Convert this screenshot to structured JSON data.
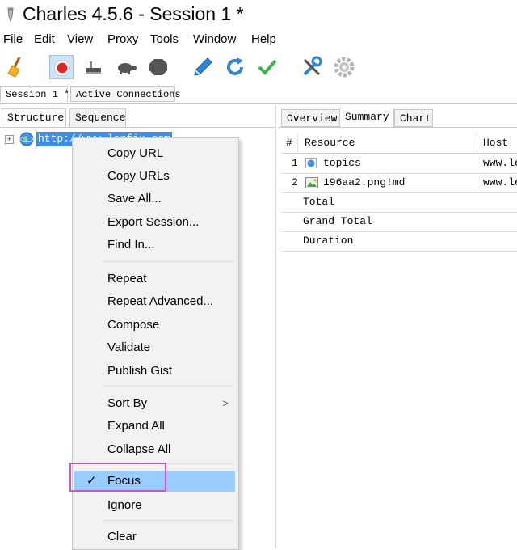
{
  "window": {
    "title": "Charles 4.5.6 - Session 1 *"
  },
  "menubar": {
    "items": [
      "File",
      "Edit",
      "View",
      "Proxy",
      "Tools",
      "Window",
      "Help"
    ]
  },
  "toolbar": {
    "icons": [
      "broom-icon",
      "record-icon",
      "throttle-icon",
      "turtle-icon",
      "stop-icon",
      "pen-icon",
      "refresh-icon",
      "checkmark-icon",
      "tools-icon",
      "settings-gear-icon"
    ],
    "record_color": "#e02424",
    "accent_blue": "#2f86d6",
    "check_green": "#3bb54a"
  },
  "session_tabs": [
    "Session 1 *",
    "Active Connections"
  ],
  "left_pane": {
    "tabs": [
      "Structure",
      "Sequence"
    ],
    "tree": {
      "expander": "+",
      "host": "http://www.lerfix.com"
    }
  },
  "right_pane": {
    "tabs": [
      "Overview",
      "Summary",
      "Chart"
    ],
    "table": {
      "columns": [
        "#",
        "Resource",
        "Host"
      ],
      "rows": [
        {
          "num": "1",
          "resource": "topics",
          "host": "www.le",
          "icon": "globe-icon"
        },
        {
          "num": "2",
          "resource": "196aa2.png!md",
          "host": "www.le",
          "icon": "image-icon"
        }
      ],
      "summary_rows": [
        "Total",
        "Grand Total",
        "Duration"
      ]
    }
  },
  "context_menu": {
    "groups": [
      [
        "Copy URL",
        "Copy URLs",
        "Save All...",
        "Export Session...",
        "Find In..."
      ],
      [
        "Repeat",
        "Repeat Advanced...",
        "Compose",
        "Validate",
        "Publish Gist"
      ],
      [
        "Sort By",
        "Expand All",
        "Collapse All"
      ],
      [
        "Focus",
        "Ignore"
      ],
      [
        "Clear"
      ]
    ],
    "submenu_arrow": ">",
    "checked_mark": "✓",
    "selected_item": "Focus",
    "selected_color": "#99ccff",
    "annotation_color": "#d44fd4"
  }
}
